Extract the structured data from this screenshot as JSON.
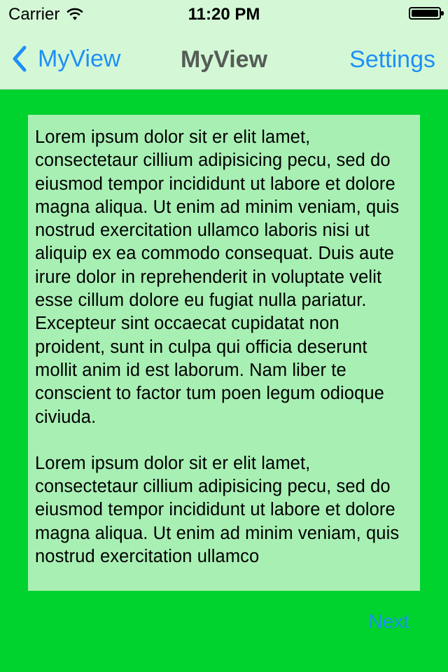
{
  "status_bar": {
    "carrier": "Carrier",
    "time": "11:20 PM"
  },
  "nav": {
    "back_label": "MyView",
    "title": "MyView",
    "right_label": "Settings"
  },
  "content": {
    "paragraphs": [
      "Lorem ipsum dolor sit er elit lamet, consectetaur cillium adipisicing pecu, sed do eiusmod tempor incididunt ut labore et dolore magna aliqua. Ut enim ad minim veniam, quis nostrud exercitation ullamco laboris nisi ut aliquip ex ea commodo consequat. Duis aute irure dolor in reprehenderit in voluptate velit esse cillum dolore eu fugiat nulla pariatur. Excepteur sint occaecat cupidatat non proident, sunt in culpa qui officia deserunt mollit anim id est laborum. Nam liber te conscient to factor tum poen legum odioque civiuda.",
      "Lorem ipsum dolor sit er elit lamet, consectetaur cillium adipisicing pecu, sed do eiusmod tempor incididunt ut labore et dolore magna aliqua. Ut enim ad minim veniam, quis nostrud exercitation ullamco"
    ]
  },
  "footer": {
    "next_label": "Next"
  },
  "colors": {
    "background": "#00d22e",
    "nav_background": "#d4f8d6",
    "text_area_background": "#a8efb4",
    "tint": "#1e8ff6"
  },
  "icons": {
    "wifi": "wifi-icon",
    "battery": "battery-icon",
    "back": "chevron-left-icon"
  }
}
